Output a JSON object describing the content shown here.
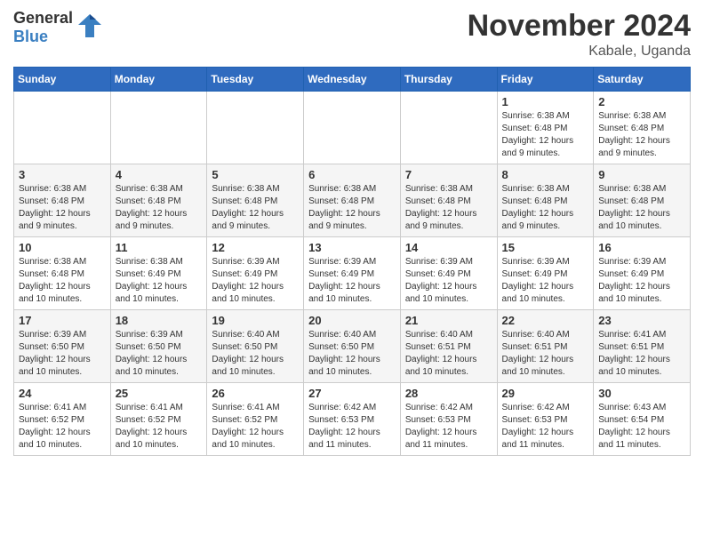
{
  "header": {
    "logo_general": "General",
    "logo_blue": "Blue",
    "month_title": "November 2024",
    "location": "Kabale, Uganda"
  },
  "days_of_week": [
    "Sunday",
    "Monday",
    "Tuesday",
    "Wednesday",
    "Thursday",
    "Friday",
    "Saturday"
  ],
  "weeks": [
    {
      "days": [
        {
          "num": "",
          "text": ""
        },
        {
          "num": "",
          "text": ""
        },
        {
          "num": "",
          "text": ""
        },
        {
          "num": "",
          "text": ""
        },
        {
          "num": "",
          "text": ""
        },
        {
          "num": "1",
          "text": "Sunrise: 6:38 AM\nSunset: 6:48 PM\nDaylight: 12 hours\nand 9 minutes."
        },
        {
          "num": "2",
          "text": "Sunrise: 6:38 AM\nSunset: 6:48 PM\nDaylight: 12 hours\nand 9 minutes."
        }
      ]
    },
    {
      "days": [
        {
          "num": "3",
          "text": "Sunrise: 6:38 AM\nSunset: 6:48 PM\nDaylight: 12 hours\nand 9 minutes."
        },
        {
          "num": "4",
          "text": "Sunrise: 6:38 AM\nSunset: 6:48 PM\nDaylight: 12 hours\nand 9 minutes."
        },
        {
          "num": "5",
          "text": "Sunrise: 6:38 AM\nSunset: 6:48 PM\nDaylight: 12 hours\nand 9 minutes."
        },
        {
          "num": "6",
          "text": "Sunrise: 6:38 AM\nSunset: 6:48 PM\nDaylight: 12 hours\nand 9 minutes."
        },
        {
          "num": "7",
          "text": "Sunrise: 6:38 AM\nSunset: 6:48 PM\nDaylight: 12 hours\nand 9 minutes."
        },
        {
          "num": "8",
          "text": "Sunrise: 6:38 AM\nSunset: 6:48 PM\nDaylight: 12 hours\nand 9 minutes."
        },
        {
          "num": "9",
          "text": "Sunrise: 6:38 AM\nSunset: 6:48 PM\nDaylight: 12 hours\nand 10 minutes."
        }
      ]
    },
    {
      "days": [
        {
          "num": "10",
          "text": "Sunrise: 6:38 AM\nSunset: 6:48 PM\nDaylight: 12 hours\nand 10 minutes."
        },
        {
          "num": "11",
          "text": "Sunrise: 6:38 AM\nSunset: 6:49 PM\nDaylight: 12 hours\nand 10 minutes."
        },
        {
          "num": "12",
          "text": "Sunrise: 6:39 AM\nSunset: 6:49 PM\nDaylight: 12 hours\nand 10 minutes."
        },
        {
          "num": "13",
          "text": "Sunrise: 6:39 AM\nSunset: 6:49 PM\nDaylight: 12 hours\nand 10 minutes."
        },
        {
          "num": "14",
          "text": "Sunrise: 6:39 AM\nSunset: 6:49 PM\nDaylight: 12 hours\nand 10 minutes."
        },
        {
          "num": "15",
          "text": "Sunrise: 6:39 AM\nSunset: 6:49 PM\nDaylight: 12 hours\nand 10 minutes."
        },
        {
          "num": "16",
          "text": "Sunrise: 6:39 AM\nSunset: 6:49 PM\nDaylight: 12 hours\nand 10 minutes."
        }
      ]
    },
    {
      "days": [
        {
          "num": "17",
          "text": "Sunrise: 6:39 AM\nSunset: 6:50 PM\nDaylight: 12 hours\nand 10 minutes."
        },
        {
          "num": "18",
          "text": "Sunrise: 6:39 AM\nSunset: 6:50 PM\nDaylight: 12 hours\nand 10 minutes."
        },
        {
          "num": "19",
          "text": "Sunrise: 6:40 AM\nSunset: 6:50 PM\nDaylight: 12 hours\nand 10 minutes."
        },
        {
          "num": "20",
          "text": "Sunrise: 6:40 AM\nSunset: 6:50 PM\nDaylight: 12 hours\nand 10 minutes."
        },
        {
          "num": "21",
          "text": "Sunrise: 6:40 AM\nSunset: 6:51 PM\nDaylight: 12 hours\nand 10 minutes."
        },
        {
          "num": "22",
          "text": "Sunrise: 6:40 AM\nSunset: 6:51 PM\nDaylight: 12 hours\nand 10 minutes."
        },
        {
          "num": "23",
          "text": "Sunrise: 6:41 AM\nSunset: 6:51 PM\nDaylight: 12 hours\nand 10 minutes."
        }
      ]
    },
    {
      "days": [
        {
          "num": "24",
          "text": "Sunrise: 6:41 AM\nSunset: 6:52 PM\nDaylight: 12 hours\nand 10 minutes."
        },
        {
          "num": "25",
          "text": "Sunrise: 6:41 AM\nSunset: 6:52 PM\nDaylight: 12 hours\nand 10 minutes."
        },
        {
          "num": "26",
          "text": "Sunrise: 6:41 AM\nSunset: 6:52 PM\nDaylight: 12 hours\nand 10 minutes."
        },
        {
          "num": "27",
          "text": "Sunrise: 6:42 AM\nSunset: 6:53 PM\nDaylight: 12 hours\nand 11 minutes."
        },
        {
          "num": "28",
          "text": "Sunrise: 6:42 AM\nSunset: 6:53 PM\nDaylight: 12 hours\nand 11 minutes."
        },
        {
          "num": "29",
          "text": "Sunrise: 6:42 AM\nSunset: 6:53 PM\nDaylight: 12 hours\nand 11 minutes."
        },
        {
          "num": "30",
          "text": "Sunrise: 6:43 AM\nSunset: 6:54 PM\nDaylight: 12 hours\nand 11 minutes."
        }
      ]
    }
  ]
}
